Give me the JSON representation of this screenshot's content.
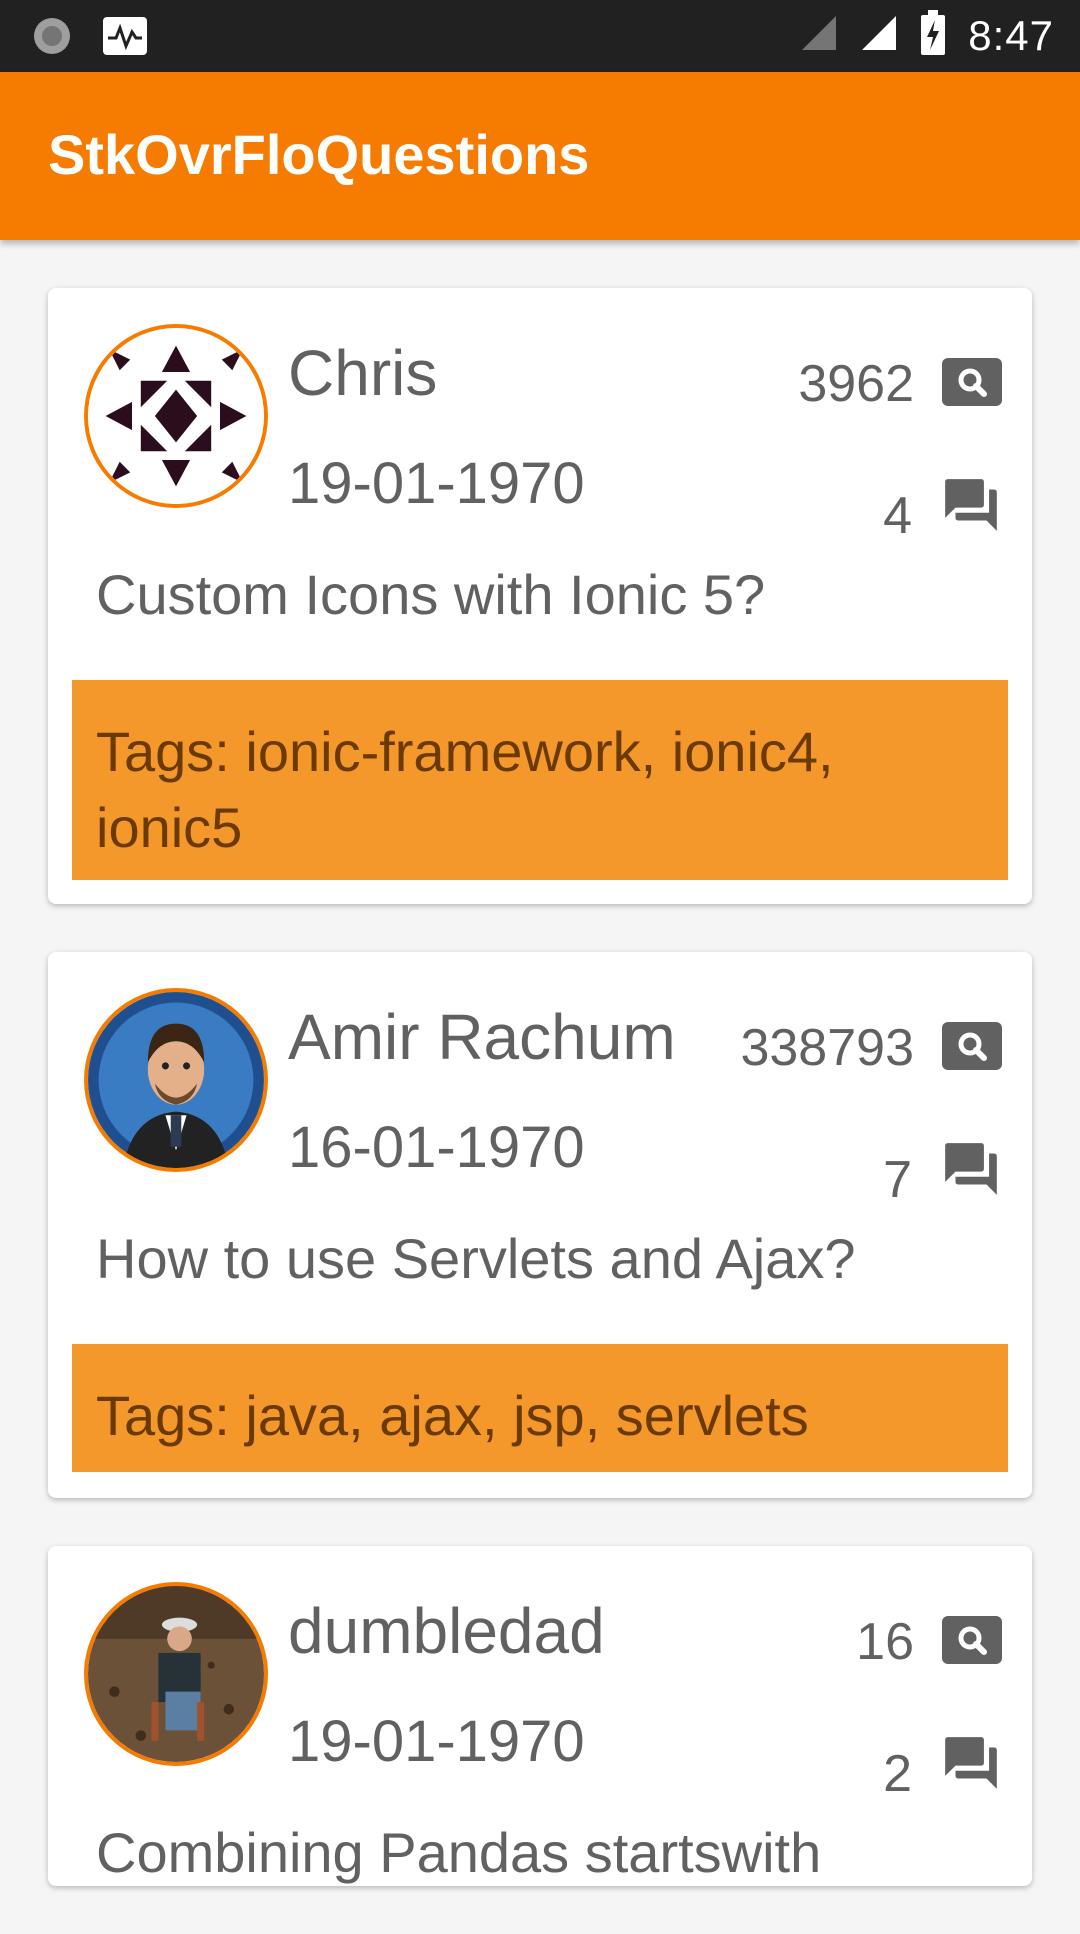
{
  "status_bar": {
    "time": "8:47",
    "left_icons": [
      "sync-icon",
      "activity-icon"
    ],
    "right_icons": [
      "signal-weak-icon",
      "signal-icon",
      "battery-charging-icon"
    ]
  },
  "app_bar": {
    "title": "StkOvrFloQuestions"
  },
  "questions": [
    {
      "owner": "Chris",
      "date": "19-01-1970",
      "views": "3962",
      "answers": "4",
      "title": "Custom Icons with Ionic 5?",
      "tags": "Tags: ionic-framework, ionic4, ionic5"
    },
    {
      "owner": "Amir Rachum",
      "date": "16-01-1970",
      "views": "338793",
      "answers": "7",
      "title": "How to use Servlets and Ajax?",
      "tags": "Tags: java, ajax, jsp, servlets"
    },
    {
      "owner": "dumbledad",
      "date": "19-01-1970",
      "views": "16",
      "answers": "2",
      "title": "Combining Pandas startswith",
      "tags": ""
    }
  ],
  "colors": {
    "accent": "#f57c00",
    "tag_bg": "#f5982b",
    "tag_text": "#6b3a00"
  }
}
